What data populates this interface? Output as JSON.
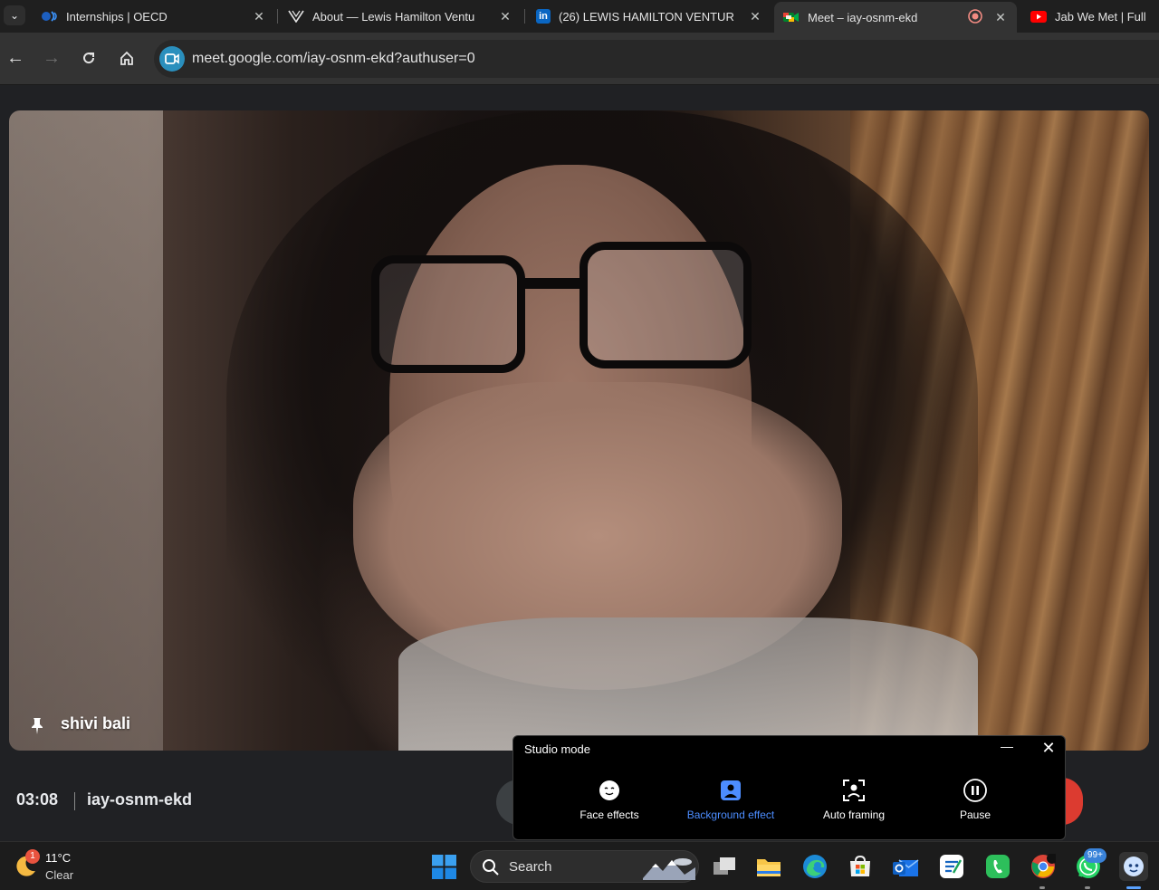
{
  "browser": {
    "tabs": [
      {
        "title": "Internships | OECD",
        "icon": "oecd-logo-icon",
        "active": false
      },
      {
        "title": "About — Lewis Hamilton Ventu",
        "icon": "lh-ventures-logo-icon",
        "active": false
      },
      {
        "title": "(26) LEWIS HAMILTON VENTUR",
        "icon": "linkedin-logo-icon",
        "icon_text": "in",
        "active": false
      },
      {
        "title": "Meet – iay-osnm-ekd",
        "icon": "google-meet-logo-icon",
        "active": true
      },
      {
        "title": "Jab We Met | Full M",
        "icon": "youtube-logo-icon",
        "active": false
      }
    ],
    "url": "meet.google.com/iay-osnm-ekd?authuser=0"
  },
  "meet": {
    "participant_name": "shivi bali",
    "elapsed_time": "03:08",
    "meeting_code": "iay-osnm-ekd"
  },
  "studio_mode": {
    "title": "Studio mode",
    "items": [
      {
        "label": "Face effects",
        "icon": "face-effects-icon",
        "selected": false
      },
      {
        "label": "Background effect",
        "icon": "background-effect-icon",
        "selected": true
      },
      {
        "label": "Auto framing",
        "icon": "auto-framing-icon",
        "selected": false
      },
      {
        "label": "Pause",
        "icon": "pause-icon",
        "selected": false
      }
    ]
  },
  "taskbar": {
    "weather": {
      "temp": "11°C",
      "condition": "Clear",
      "badge": "1"
    },
    "search_label": "Search",
    "badge_whatsapp": "99+"
  },
  "colors": {
    "accent_blue": "#4c8dff",
    "leave_red": "#dc3b30",
    "meet_bg": "#202124"
  }
}
